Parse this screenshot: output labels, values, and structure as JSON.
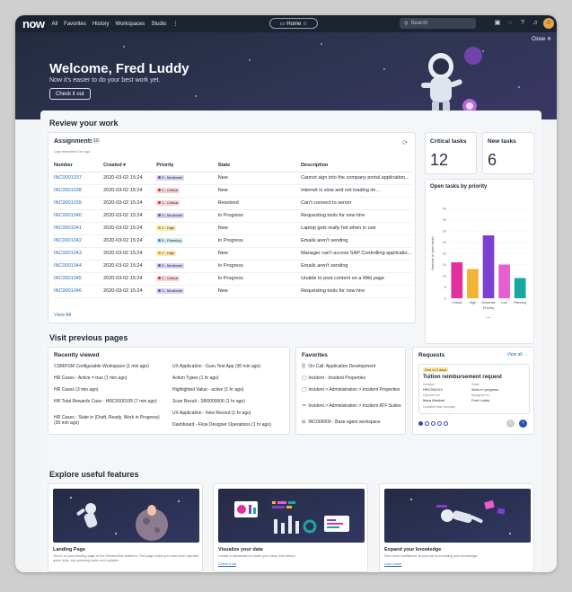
{
  "topnav": {
    "logo": "now",
    "items": [
      "All",
      "Favorites",
      "History",
      "Workspaces",
      "Studio",
      "⋮"
    ],
    "home_pill": "Home ☆",
    "search_placeholder": "Search",
    "icons": [
      "briefcase-icon",
      "chat-icon",
      "help-icon",
      "bell-icon",
      "user-avatar"
    ]
  },
  "hero": {
    "title": "Welcome, Fred Luddy",
    "subtitle": "Now it's easier to do your best work yet.",
    "button": "Check it out",
    "close": "Close ✕"
  },
  "review": {
    "section_title": "Review your work",
    "assignments": {
      "title": "Assignments",
      "count": "10",
      "refreshed": "Last refreshed 1m ago",
      "columns": [
        "Number",
        "Created ▾",
        "Priority",
        "State",
        "Description"
      ],
      "rows": [
        {
          "number": "INC0001037",
          "created": "2020-03-02 15:24",
          "priority": "3 - Moderate",
          "pcolor": "#d9d4f2",
          "pdot": "#6a4fc7",
          "state": "New",
          "desc": "Cannot sign into the company portal application..."
        },
        {
          "number": "INC0001038",
          "created": "2020-03-02 15:24",
          "priority": "1 - Critical",
          "pcolor": "#f8d3d6",
          "pdot": "#d9262e",
          "state": "New",
          "desc": "Internet is slow and not loading im..."
        },
        {
          "number": "INC0001039",
          "created": "2020-03-02 15:24",
          "priority": "1 - Critical",
          "pcolor": "#f8d3d6",
          "pdot": "#d9262e",
          "state": "Resolved",
          "desc": "Can't connect to server"
        },
        {
          "number": "INC0001040",
          "created": "2020-03-02 15:24",
          "priority": "3 - Moderate",
          "pcolor": "#d9d4f2",
          "pdot": "#6a4fc7",
          "state": "In Progress",
          "desc": "Requesting tools for new hire"
        },
        {
          "number": "INC0001041",
          "created": "2020-03-02 15:24",
          "priority": "2 - High",
          "pcolor": "#fbeab3",
          "pdot": "#e0a500",
          "state": "New",
          "desc": "Laptop gets really hot when in use"
        },
        {
          "number": "INC0001042",
          "created": "2020-03-02 15:24",
          "priority": "5 - Planning",
          "pcolor": "#d2eef0",
          "pdot": "#1b9aa8",
          "state": "In Progress",
          "desc": "Emails aren't sending"
        },
        {
          "number": "INC0001043",
          "created": "2020-03-02 15:24",
          "priority": "2 - High",
          "pcolor": "#fbeab3",
          "pdot": "#e0a500",
          "state": "New",
          "desc": "Manager can't access SAP Controlling applicatio..."
        },
        {
          "number": "INC0001044",
          "created": "2020-03-02 15:24",
          "priority": "3 - Moderate",
          "pcolor": "#d9d4f2",
          "pdot": "#6a4fc7",
          "state": "In Progress",
          "desc": "Emails aren't sending"
        },
        {
          "number": "INC0001045",
          "created": "2020-03-02 15:24",
          "priority": "1 - Critical",
          "pcolor": "#f8d3d6",
          "pdot": "#d9262e",
          "state": "In Progress",
          "desc": "Unable to post content on a Wiki page"
        },
        {
          "number": "INC0001046",
          "created": "2020-03-02 15:24",
          "priority": "3 - Moderate",
          "pcolor": "#d9d4f2",
          "pdot": "#6a4fc7",
          "state": "New",
          "desc": "Requesting tools for new hire"
        }
      ],
      "view_all": "View All"
    },
    "critical_tasks": {
      "label": "Critical tasks",
      "value": "12"
    },
    "new_tasks": {
      "label": "New tasks",
      "value": "6"
    }
  },
  "chart_data": {
    "type": "bar",
    "title": "Open tasks by priority",
    "categories": [
      "Critical",
      "High",
      "Moderate",
      "Low",
      "Planning"
    ],
    "values": [
      16,
      13,
      28,
      15,
      9
    ],
    "colors": [
      "#e0329a",
      "#f2b233",
      "#7d3fd1",
      "#e65ecf",
      "#1aa7a0"
    ],
    "xlabel": "Priority",
    "ylabel": "Number of open tasks",
    "ylim": [
      0,
      40
    ],
    "yticks": [
      0,
      5,
      10,
      15,
      20,
      25,
      30,
      35,
      40
    ],
    "legend_dash": "—"
  },
  "visit": {
    "section_title": "Visit previous pages",
    "recently_viewed": {
      "title": "Recently viewed",
      "left": [
        "CSM/FSM Configurable Workspace (1 min ago)",
        "HR Cases - Active = true (1 min ago)",
        "HR Cases (3 min ago)",
        "HR Total Rewards Case - HRC0000105 (7 min ago)",
        "HR Cases - State in (Draft, Ready, Work in Progress) (30 min ago)"
      ],
      "right": [
        "UX Application - Guru Test App (30 min ago)",
        "Action Types (1 hr ago)",
        "Highlighted Value - active (1 hr ago)",
        "Scan Result - SR0000006 (1 hr ago)",
        "UX Application - New Record (1 hr ago)",
        "Dashboard - Flow Designer Operations (1 hr ago)"
      ]
    },
    "favorites": {
      "title": "Favorites",
      "items": [
        {
          "icon": "document-icon",
          "glyph": "🗎",
          "label": "On-Call: Application Development"
        },
        {
          "icon": "circle-icon",
          "glyph": "◯",
          "label": "Incident - Incident Properties"
        },
        {
          "icon": "circle-icon",
          "glyph": "◯",
          "label": "Incident > Administration > Incident Properties"
        },
        {
          "icon": "list-icon",
          "glyph": "≔",
          "label": "Incident > Administration > Incident ATF Suites"
        },
        {
          "icon": "grid-icon",
          "glyph": "⊞",
          "label": "INC009009 - Base agent workspace"
        }
      ]
    },
    "requests": {
      "title": "Requests",
      "view_all": "View all →",
      "due": "Due in 2 days",
      "card_title": "Tuition reimbursement request",
      "number_label": "Number",
      "number": "HRC000119",
      "state_label": "State",
      "state": "Work in progress",
      "opened_for_label": "Opened for",
      "opened_for": "Mara Bradnet",
      "assigned_label": "Assigned to",
      "assigned": "Fred Luddy",
      "updated": "Updated last Monday"
    }
  },
  "explore": {
    "section_title": "Explore useful features",
    "cards": [
      {
        "title": "Landing Page",
        "desc": "You're on your landing page of the ServiceNow platform. This page helps you start each day with quick links, any pressing tasks and updates.",
        "link": ""
      },
      {
        "title": "Visualize your data",
        "desc": "Create a dashboard to share your story with others.",
        "link": "Check it out"
      },
      {
        "title": "Expand your knowledge",
        "desc": "Find more confidence at your job by boosting your knowledge.",
        "link": "Learn more"
      }
    ]
  }
}
